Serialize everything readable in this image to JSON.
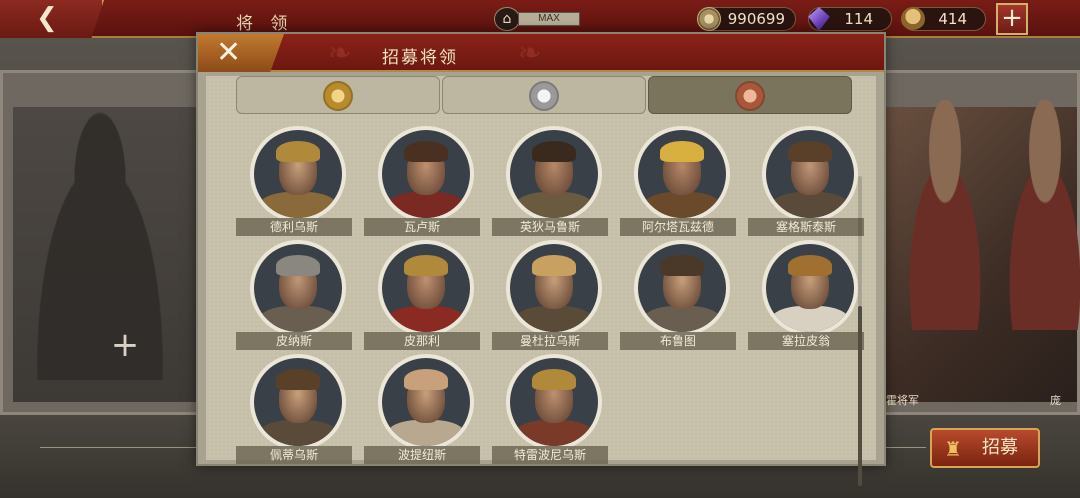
{
  "topbar": {
    "back_icon": "back-arrow-icon",
    "title": "将 领",
    "temple_level": "MAX",
    "gold": "990699",
    "gems": "114",
    "helmets": "414",
    "plus_label": "+"
  },
  "modal": {
    "close_label": "✕",
    "title": "招募将领",
    "tabs": [
      {
        "icon": "gold-helmet-emblem-icon",
        "active": false
      },
      {
        "icon": "silver-helmet-emblem-icon",
        "active": false
      },
      {
        "icon": "bronze-helmet-emblem-icon",
        "active": true
      }
    ],
    "heroes": [
      {
        "name": "德利乌斯",
        "skin": "#c8a07a",
        "hair": "#b08a3a",
        "armor": "#8a6a3a"
      },
      {
        "name": "瓦卢斯",
        "skin": "#c09070",
        "hair": "#4a3020",
        "armor": "#7a2a22"
      },
      {
        "name": "英狄马鲁斯",
        "skin": "#b88868",
        "hair": "#3a2a1e",
        "armor": "#6a5a40"
      },
      {
        "name": "阿尔塔瓦兹德",
        "skin": "#b88868",
        "hair": "#d8b040",
        "armor": "#6a4a2a"
      },
      {
        "name": "塞格斯泰斯",
        "skin": "#c09878",
        "hair": "#5a4028",
        "armor": "#5a4a3a"
      },
      {
        "name": "皮纳斯",
        "skin": "#c09878",
        "hair": "#8a8680",
        "armor": "#6a5e50"
      },
      {
        "name": "皮那利",
        "skin": "#c09070",
        "hair": "#b08a3a",
        "armor": "#8a2a22"
      },
      {
        "name": "曼杜拉乌斯",
        "skin": "#c8a07a",
        "hair": "#c8a060",
        "armor": "#5a4a38"
      },
      {
        "name": "布鲁图",
        "skin": "#c8a07a",
        "hair": "#4a3828",
        "armor": "#6a5e50"
      },
      {
        "name": "塞拉皮翁",
        "skin": "#c8a07a",
        "hair": "#a07030",
        "armor": "#d8d0c0"
      },
      {
        "name": "佩蒂乌斯",
        "skin": "#c8a07a",
        "hair": "#5a4028",
        "armor": "#5a4a3a"
      },
      {
        "name": "波提纽斯",
        "skin": "#c8a07a",
        "hair": "#c8a07a",
        "armor": "#b8a890"
      },
      {
        "name": "特雷波尼乌斯",
        "skin": "#c09070",
        "hair": "#b08a3a",
        "armor": "#7a3a2a"
      }
    ]
  },
  "background": {
    "right_name_1": "霍将军",
    "right_name_2": "庞"
  },
  "recruit_button": {
    "label": "招募",
    "icon": "helmet-plus-icon"
  }
}
